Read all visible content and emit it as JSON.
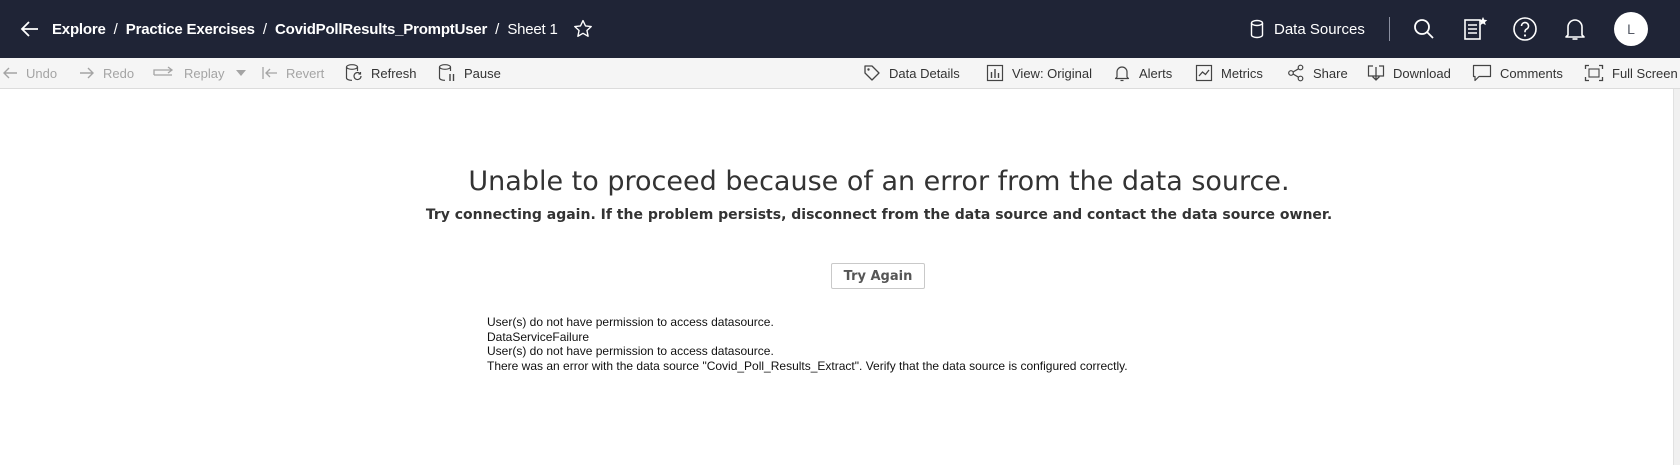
{
  "topbar": {
    "breadcrumb": [
      "Explore",
      "Practice Exercises",
      "CovidPollResults_PromptUser",
      "Sheet 1"
    ],
    "separator": "/",
    "data_sources_label": "Data Sources",
    "avatar_initial": "L",
    "background": "#1f2436"
  },
  "toolbar": {
    "undo": "Undo",
    "redo": "Redo",
    "replay": "Replay",
    "revert": "Revert",
    "refresh": "Refresh",
    "pause": "Pause",
    "data_details": "Data Details",
    "view": "View: Original",
    "alerts": "Alerts",
    "metrics": "Metrics",
    "share": "Share",
    "download": "Download",
    "comments": "Comments",
    "full_screen": "Full Screen"
  },
  "error": {
    "title": "Unable to proceed because of an error from the data source.",
    "subtitle": "Try connecting again. If the problem persists, disconnect from the data source and contact the data source owner.",
    "button": "Try Again",
    "details": [
      "User(s) do not have permission to access datasource.",
      "DataServiceFailure",
      "User(s) do not have permission to access datasource.",
      "There was an error with the data source \"Covid_Poll_Results_Extract\". Verify that the data source is configured correctly."
    ]
  }
}
